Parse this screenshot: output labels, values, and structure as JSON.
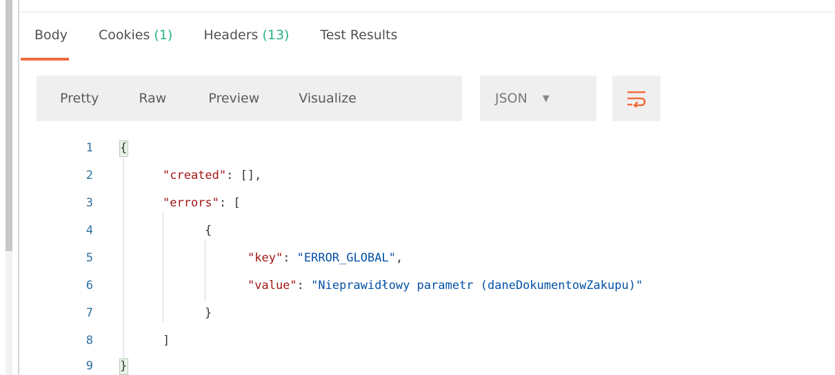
{
  "tabs": [
    {
      "label": "Body",
      "count": "",
      "active": true
    },
    {
      "label": "Cookies ",
      "count": "(1)",
      "active": false
    },
    {
      "label": "Headers ",
      "count": "(13)",
      "active": false
    },
    {
      "label": "Test Results",
      "count": "",
      "active": false
    }
  ],
  "view_options": [
    "Pretty",
    "Raw",
    "Preview",
    "Visualize"
  ],
  "format_select": {
    "selected": "JSON"
  },
  "wrap_button": {
    "icon": "wrap-lines-icon"
  },
  "code": {
    "line_numbers": [
      "1",
      "2",
      "3",
      "4",
      "5",
      "6",
      "7",
      "8",
      "9"
    ],
    "lines": {
      "l1": "{",
      "l2_key": "\"created\"",
      "l2_rest": ": [],",
      "l3_key": "\"errors\"",
      "l3_rest": ": [",
      "l4": "{",
      "l5_key": "\"key\"",
      "l5_sep": ": ",
      "l5_val": "\"ERROR_GLOBAL\"",
      "l5_end": ",",
      "l6_key": "\"value\"",
      "l6_sep": ": ",
      "l6_val": "\"Nieprawidłowy parametr (daneDokumentowZakupu)\"",
      "l7": "}",
      "l8": "]",
      "l9": "}"
    }
  },
  "colors": {
    "active_tab_underline": "#f26b3a",
    "count_green": "#26b47f",
    "json_key": "#a31515",
    "json_string": "#0451a5",
    "line_number": "#2f6f9f"
  }
}
